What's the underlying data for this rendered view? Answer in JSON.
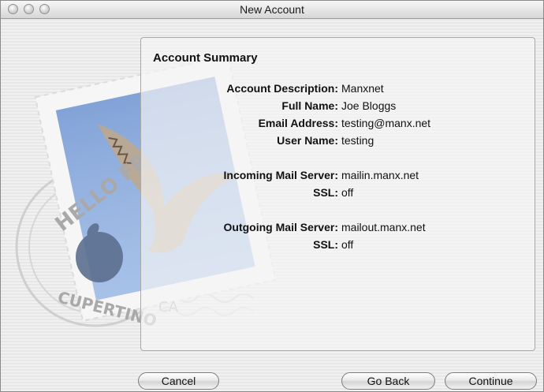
{
  "window": {
    "title": "New Account"
  },
  "stamp": {
    "text_top": "HELLO FR",
    "text_bottom": "CUPERTINO",
    "text_ca": "CA"
  },
  "summary": {
    "heading": "Account Summary",
    "rows": [
      {
        "label": "Account Description:",
        "value": "Manxnet"
      },
      {
        "label": "Full Name:",
        "value": "Joe Bloggs"
      },
      {
        "label": "Email Address:",
        "value": "testing@manx.net"
      },
      {
        "label": "User Name:",
        "value": "testing"
      },
      {
        "label": "Incoming Mail Server:",
        "value": "mailin.manx.net"
      },
      {
        "label": "SSL:",
        "value": "off"
      },
      {
        "label": "Outgoing Mail Server:",
        "value": "mailout.manx.net"
      },
      {
        "label": "SSL:",
        "value": "off"
      }
    ]
  },
  "buttons": {
    "cancel": "Cancel",
    "go_back": "Go Back",
    "continue": "Continue"
  }
}
